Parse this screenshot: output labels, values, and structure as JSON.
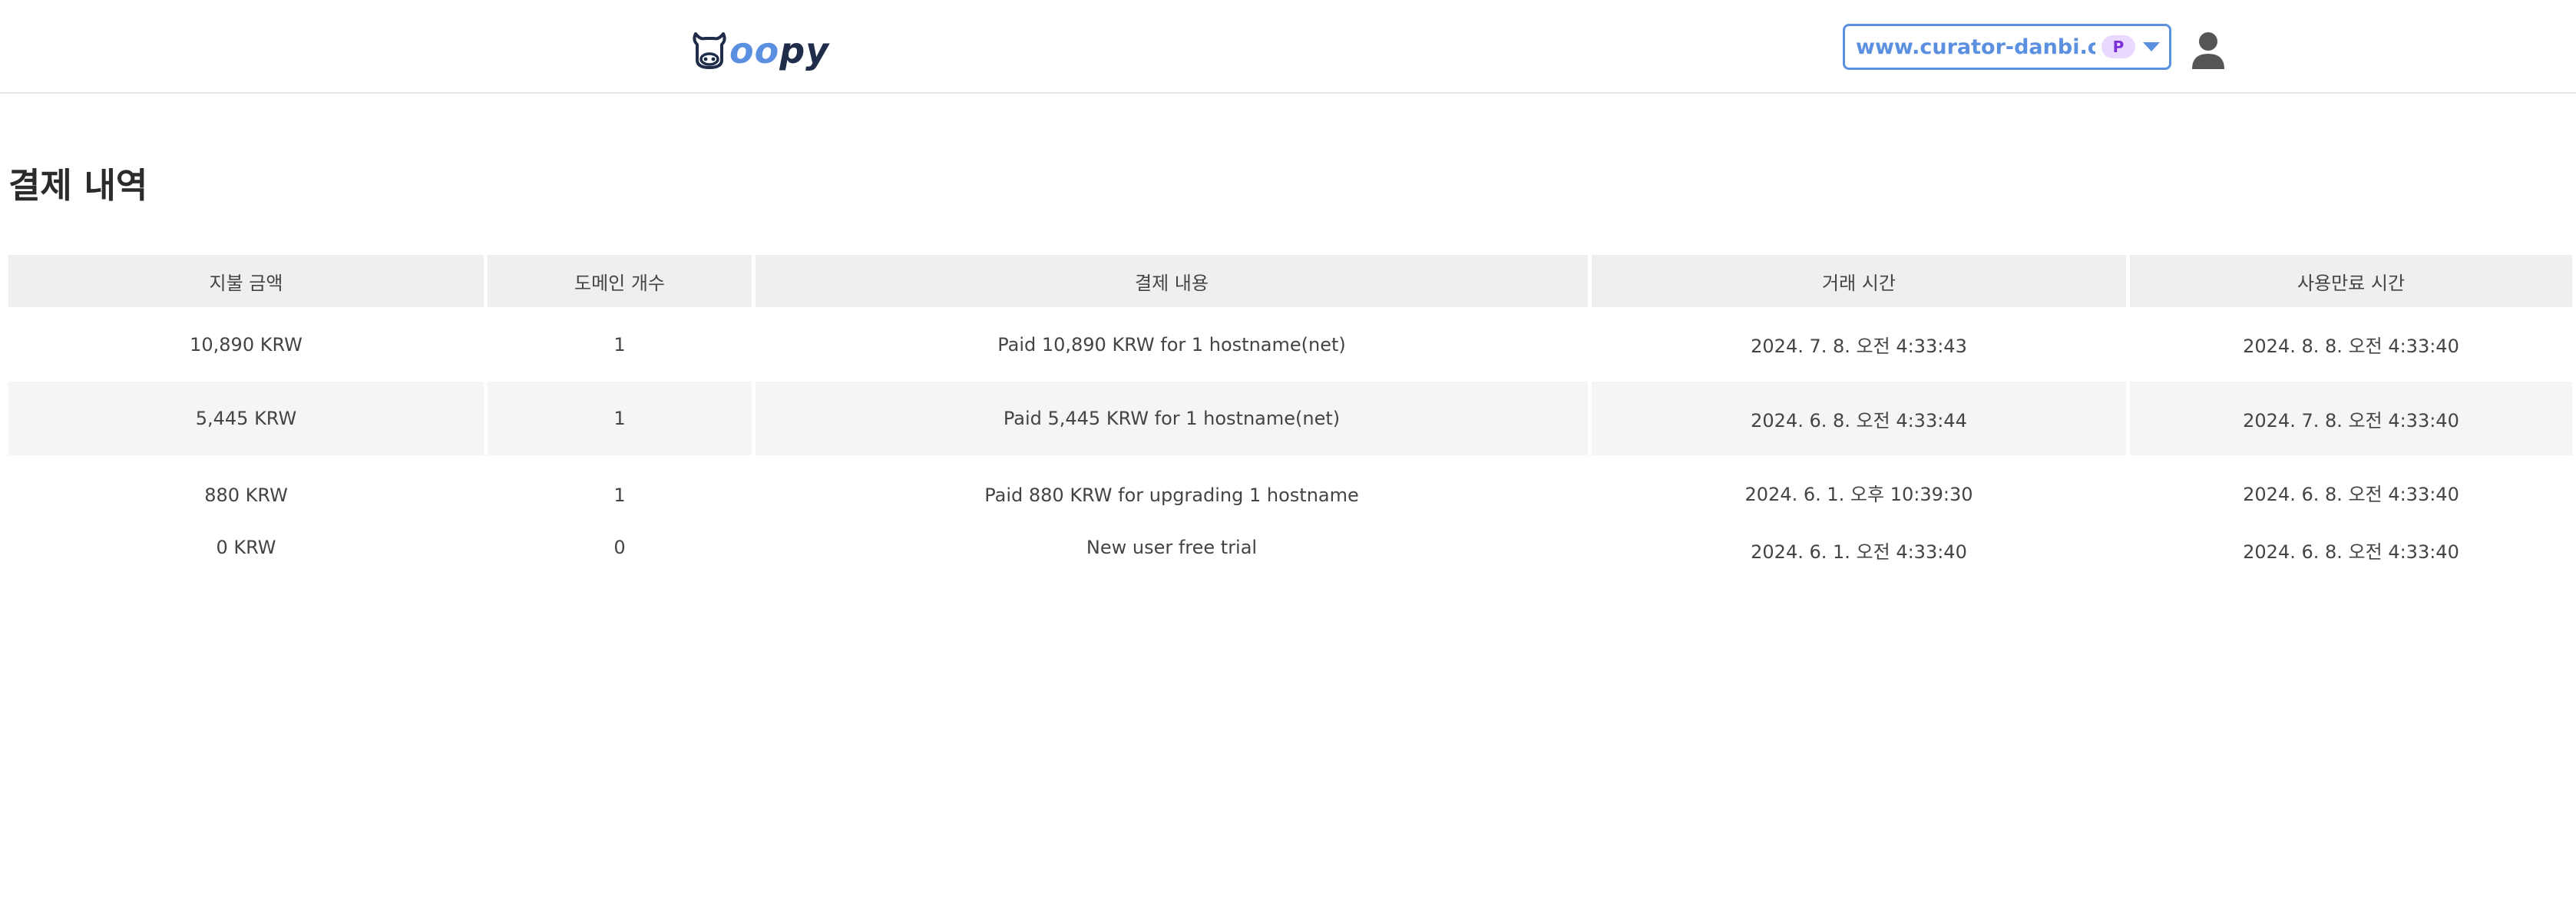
{
  "brand": {
    "name_part1": "oo",
    "name_part2": "py",
    "icon": "cow-head-icon"
  },
  "header": {
    "domain_select_value": "www.curator-danbi.c...",
    "plan_badge": "P",
    "dropdown_icon": "caret-down-icon",
    "user_icon": "user-icon",
    "accent_color": "#5b8fe0",
    "badge_color": "#e9d8ff"
  },
  "page": {
    "title": "결제 내역"
  },
  "table": {
    "columns": [
      "지불 금액",
      "도메인 개수",
      "결제 내용",
      "거래 시간",
      "사용만료 시간"
    ],
    "rows": [
      {
        "amount": "10,890 KRW",
        "domains": "1",
        "description": "Paid 10,890 KRW for 1 hostname(net)",
        "transaction_time": "2024. 7. 8. 오전 4:33:43",
        "expiry_time": "2024. 8. 8. 오전 4:33:40"
      },
      {
        "amount": "5,445 KRW",
        "domains": "1",
        "description": "Paid 5,445 KRW for 1 hostname(net)",
        "transaction_time": "2024. 6. 8. 오전 4:33:44",
        "expiry_time": "2024. 7. 8. 오전 4:33:40"
      },
      {
        "amount": "880 KRW",
        "domains": "1",
        "description": "Paid 880 KRW for upgrading 1 hostname",
        "transaction_time": "2024. 6. 1. 오후 10:39:30",
        "expiry_time": "2024. 6. 8. 오전 4:33:40"
      },
      {
        "amount": "0 KRW",
        "domains": "0",
        "description": "New user free trial",
        "transaction_time": "2024. 6. 1. 오전 4:33:40",
        "expiry_time": "2024. 6. 8. 오전 4:33:40"
      }
    ]
  }
}
